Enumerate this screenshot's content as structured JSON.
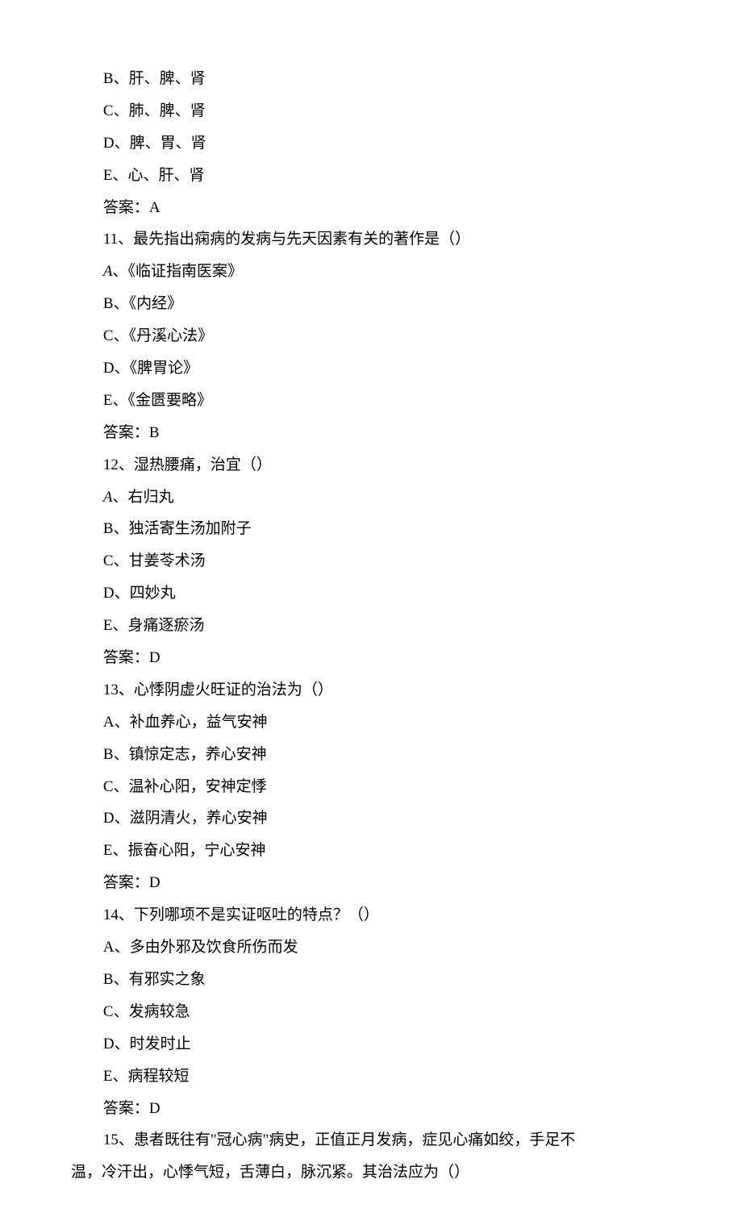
{
  "lines": [
    {
      "text": "B、肝、脾、肾"
    },
    {
      "text": "C、肺、脾、肾"
    },
    {
      "text": "D、脾、胃、肾"
    },
    {
      "text": "E、心、肝、肾"
    },
    {
      "text": "答案：A"
    },
    {
      "text": "11、最先指出痫病的发病与先天因素有关的著作是（）"
    },
    {
      "italicA": true,
      "rest": "、《临证指南医案》"
    },
    {
      "text": "B、《内经》"
    },
    {
      "text": "C、《丹溪心法》"
    },
    {
      "text": "D、《脾胃论》"
    },
    {
      "text": "E、《金匮要略》"
    },
    {
      "text": "答案：B"
    },
    {
      "text": "12、湿热腰痛，治宜（）"
    },
    {
      "italicA": true,
      "rest": "、右归丸"
    },
    {
      "text": "B、独活寄生汤加附子"
    },
    {
      "text": "C、甘姜苓术汤"
    },
    {
      "text": "D、四妙丸"
    },
    {
      "text": "E、身痛逐瘀汤"
    },
    {
      "text": "答案：D"
    },
    {
      "text": "13、心悸阴虚火旺证的治法为（）"
    },
    {
      "text": "A、补血养心，益气安神"
    },
    {
      "text": "B、镇惊定志，养心安神"
    },
    {
      "text": "C、温补心阳，安神定悸"
    },
    {
      "text": "D、滋阴清火，养心安神"
    },
    {
      "text": "E、振奋心阳，宁心安神"
    },
    {
      "text": "答案：D"
    },
    {
      "text": "14、下列哪项不是实证呕吐的特点？（）"
    },
    {
      "text": "A、多由外邪及饮食所伤而发"
    },
    {
      "text": "B、有邪实之象"
    },
    {
      "text": "C、发病较急"
    },
    {
      "text": "D、时发时止"
    },
    {
      "text": "E、病程较短"
    },
    {
      "text": "答案：D"
    },
    {
      "wrap": true,
      "first": "15、患者既往有\"冠心病\"病史，正值正月发病，症见心痛如绞，手足不",
      "second": "温，冷汗出，心悸气短，舌薄白，脉沉紧。其治法应为（）"
    }
  ]
}
